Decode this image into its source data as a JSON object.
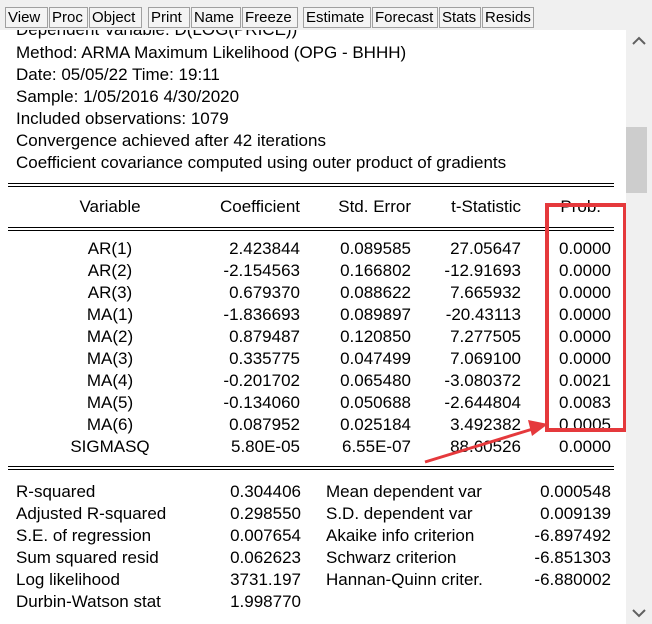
{
  "toolbar": {
    "buttons": [
      "View",
      "Proc",
      "Object",
      "Print",
      "Name",
      "Freeze",
      "Estimate",
      "Forecast",
      "Stats",
      "Resids"
    ]
  },
  "header": {
    "dependent": "Dependent Variable: D(LOG(PRICE))",
    "method": "Method: ARMA Maximum Likelihood (OPG - BHHH)",
    "date": "Date: 05/05/22   Time: 19:11",
    "sample": "Sample: 1/05/2016 4/30/2020",
    "observations": "Included observations: 1079",
    "convergence": "Convergence achieved after 42 iterations",
    "covariance": "Coefficient covariance computed using outer product of gradients"
  },
  "table": {
    "columns": [
      "Variable",
      "Coefficient",
      "Std. Error",
      "t-Statistic",
      "Prob."
    ],
    "rows": [
      [
        "AR(1)",
        "2.423844",
        "0.089585",
        "27.05647",
        "0.0000"
      ],
      [
        "AR(2)",
        "-2.154563",
        "0.166802",
        "-12.91693",
        "0.0000"
      ],
      [
        "AR(3)",
        "0.679370",
        "0.088622",
        "7.665932",
        "0.0000"
      ],
      [
        "MA(1)",
        "-1.836693",
        "0.089897",
        "-20.43113",
        "0.0000"
      ],
      [
        "MA(2)",
        "0.879487",
        "0.120850",
        "7.277505",
        "0.0000"
      ],
      [
        "MA(3)",
        "0.335775",
        "0.047499",
        "7.069100",
        "0.0000"
      ],
      [
        "MA(4)",
        "-0.201702",
        "0.065480",
        "-3.080372",
        "0.0021"
      ],
      [
        "MA(5)",
        "-0.134060",
        "0.050688",
        "-2.644804",
        "0.0083"
      ],
      [
        "MA(6)",
        "0.087952",
        "0.025184",
        "3.492382",
        "0.0005"
      ],
      [
        "SIGMASQ",
        "5.80E-05",
        "6.55E-07",
        "88.60526",
        "0.0000"
      ]
    ]
  },
  "stats": {
    "left": [
      [
        "R-squared",
        "0.304406"
      ],
      [
        "Adjusted R-squared",
        "0.298550"
      ],
      [
        "S.E. of regression",
        "0.007654"
      ],
      [
        "Sum squared resid",
        "0.062623"
      ],
      [
        "Log likelihood",
        "3731.197"
      ],
      [
        "Durbin-Watson stat",
        "1.998770"
      ]
    ],
    "right": [
      [
        "Mean dependent var",
        "0.000548"
      ],
      [
        "S.D. dependent var",
        "0.009139"
      ],
      [
        "Akaike info criterion",
        "-6.897492"
      ],
      [
        "Schwarz criterion",
        "-6.851303"
      ],
      [
        "Hannan-Quinn criter.",
        "-6.880002"
      ]
    ]
  },
  "colors": {
    "highlight": "#e5393c"
  }
}
